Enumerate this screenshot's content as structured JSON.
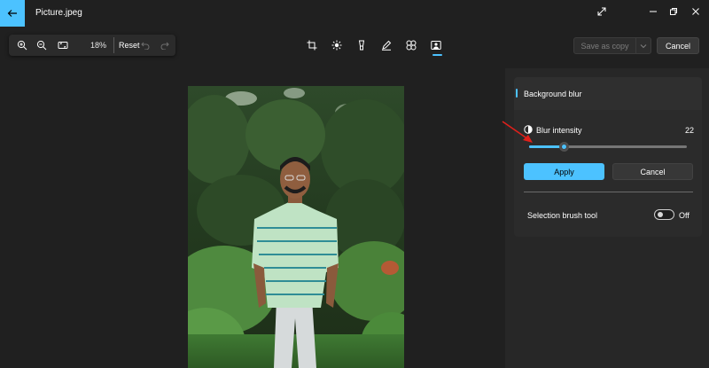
{
  "window": {
    "title": "Picture.jpeg",
    "back_icon": "back-arrow-icon",
    "accent_color": "#4cc2ff"
  },
  "toolbar": {
    "zoom_in_icon": "zoom-in-icon",
    "zoom_out_icon": "zoom-out-icon",
    "fit_icon": "fit-to-window-icon",
    "zoom_level": "18%",
    "reset_label": "Reset",
    "undo_icon": "undo-icon",
    "redo_icon": "redo-icon",
    "tools": [
      {
        "name": "crop",
        "icon": "crop-icon"
      },
      {
        "name": "adjust",
        "icon": "brightness-icon"
      },
      {
        "name": "erase",
        "icon": "erase-icon"
      },
      {
        "name": "markup",
        "icon": "pen-icon"
      },
      {
        "name": "filter",
        "icon": "filter-icon"
      },
      {
        "name": "background",
        "icon": "background-icon",
        "active": true
      }
    ],
    "save_copy_label": "Save as copy",
    "cancel_label": "Cancel"
  },
  "panel": {
    "title": "Background blur",
    "blur_intensity_label": "Blur intensity",
    "blur_intensity_value": "22",
    "blur_intensity_fraction": 0.22,
    "apply_label": "Apply",
    "cancel_label": "Cancel",
    "selection_brush_label": "Selection brush tool",
    "selection_brush_state": "Off"
  }
}
